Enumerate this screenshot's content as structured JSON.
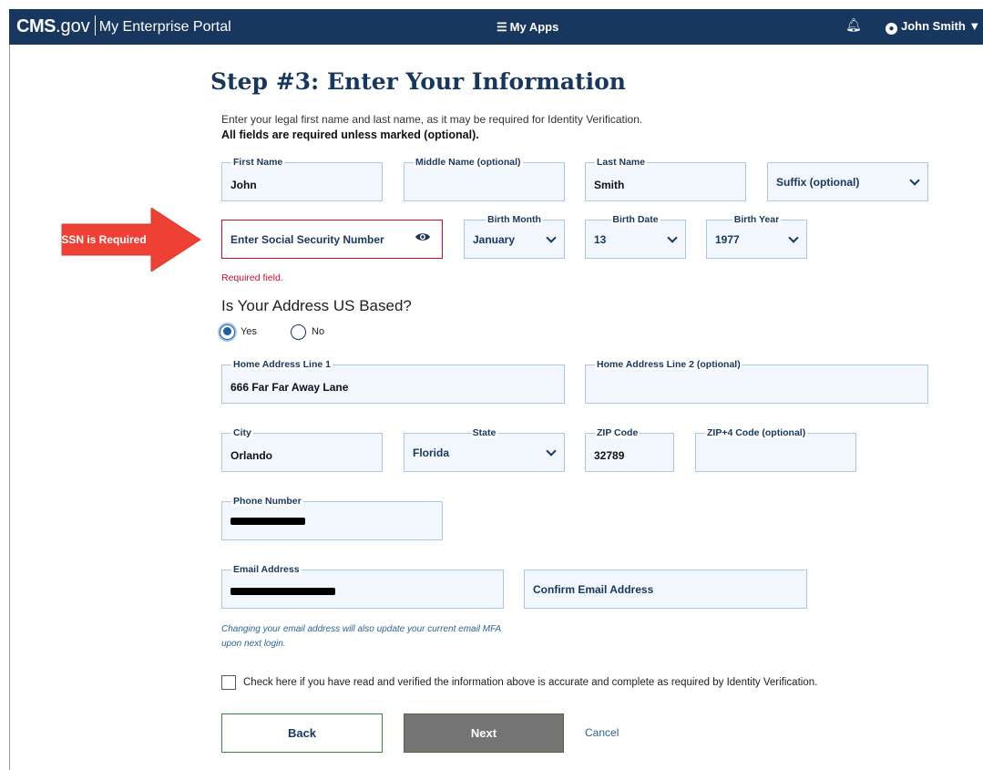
{
  "header": {
    "brand_bold": "CMS",
    "brand_gov": ".gov",
    "brand_portal": "My Enterprise Portal",
    "my_apps": "My Apps",
    "user_name": "John Smith"
  },
  "page": {
    "title": "Step #3: Enter Your Information",
    "intro": "Enter your legal first name and last name, as it may be required for Identity Verification.",
    "required_note": "All fields are required unless marked (optional)."
  },
  "annotation": {
    "text": "SSN is Required"
  },
  "fields": {
    "first_name": {
      "label": "First Name",
      "value": "John"
    },
    "middle_name": {
      "label": "Middle Name (optional)",
      "value": ""
    },
    "last_name": {
      "label": "Last Name",
      "value": "Smith"
    },
    "suffix": {
      "placeholder": "Suffix (optional)"
    },
    "ssn": {
      "placeholder": "Enter Social Security Number",
      "error": "Required field."
    },
    "birth_month": {
      "label": "Birth Month",
      "value": "January"
    },
    "birth_date": {
      "label": "Birth Date",
      "value": "13"
    },
    "birth_year": {
      "label": "Birth Year",
      "value": "1977"
    },
    "address_question": "Is Your Address US Based?",
    "radio_yes": "Yes",
    "radio_no": "No",
    "address1": {
      "label": "Home Address Line 1",
      "value": "666 Far Far Away Lane"
    },
    "address2": {
      "label": "Home Address Line 2 (optional)",
      "value": ""
    },
    "city": {
      "label": "City",
      "value": "Orlando"
    },
    "state": {
      "label": "State",
      "value": "Florida"
    },
    "zip": {
      "label": "ZIP Code",
      "value": "32789"
    },
    "zip4": {
      "label": "ZIP+4 Code (optional)",
      "value": ""
    },
    "phone": {
      "label": "Phone Number"
    },
    "email": {
      "label": "Email Address"
    },
    "confirm_email": {
      "placeholder": "Confirm Email Address"
    },
    "email_note": "Changing your email address will also update your current email MFA upon next login."
  },
  "verify": {
    "label": "Check here if you have read and verified the information above is accurate and complete as required by Identity Verification."
  },
  "buttons": {
    "back": "Back",
    "next": "Next",
    "cancel": "Cancel"
  },
  "colors": {
    "header_bg": "#17375e",
    "error": "#c8102e",
    "annotation": "#ef4035",
    "next_bg": "#747474",
    "back_border": "#2e8540"
  }
}
